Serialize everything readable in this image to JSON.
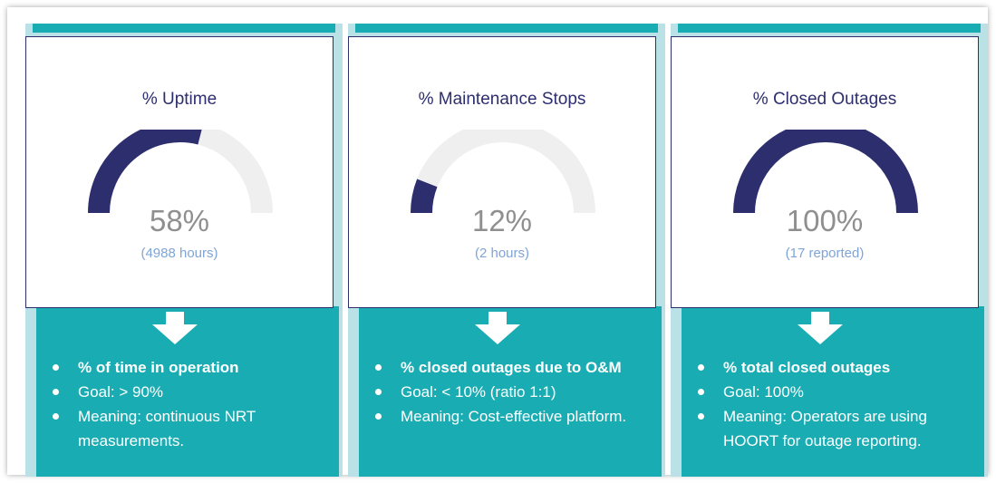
{
  "colors": {
    "gauge_fill": "#2d2e6e",
    "gauge_track": "#efefef",
    "panel_teal": "#1aacb3",
    "panel_light": "#b9e1e6"
  },
  "cards": [
    {
      "title": "% Uptime",
      "value": "58%",
      "fraction": 0.58,
      "sub": "(4988 hours)",
      "bullets": [
        "% of time in operation",
        "Goal: > 90%",
        "Meaning: continuous NRT measurements."
      ]
    },
    {
      "title": "% Maintenance Stops",
      "value": "12%",
      "fraction": 0.12,
      "sub": "(2 hours)",
      "bullets": [
        "% closed outages due to O&M",
        "Goal: < 10% (ratio 1:1)",
        "Meaning: Cost-effective platform."
      ]
    },
    {
      "title": "% Closed Outages",
      "value": "100%",
      "fraction": 1.0,
      "sub": "(17 reported)",
      "bullets": [
        "% total closed outages",
        "Goal: 100%",
        "Meaning: Operators are using HOORT for outage reporting."
      ]
    }
  ]
}
